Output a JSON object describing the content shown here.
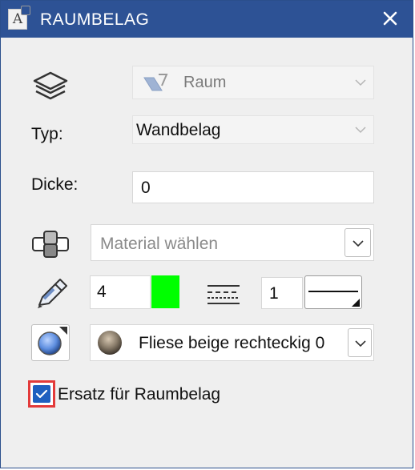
{
  "window": {
    "title": "RAUMBELAG",
    "title_icon_letter": "A"
  },
  "layer": {
    "value": "Raum"
  },
  "typ": {
    "label": "Typ:",
    "value": "Wandbelag"
  },
  "dicke": {
    "label": "Dicke:",
    "value": "0"
  },
  "material": {
    "placeholder": "Material wählen"
  },
  "pen": {
    "value": "4",
    "color": "#00ff00"
  },
  "linetype": {
    "value": "1"
  },
  "surface": {
    "value": "Fliese beige rechteckig 0"
  },
  "ersatz": {
    "label": "Ersatz für Raumbelag",
    "checked": true
  },
  "colors": {
    "title_bar": "#2d5295",
    "accent": "#1f5fbf",
    "highlight": "#e33a3a"
  }
}
